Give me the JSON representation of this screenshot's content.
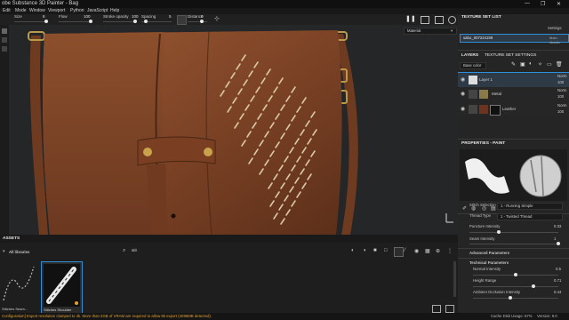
{
  "window": {
    "title": "obe Substance 3D Painter - Bag",
    "controls": [
      "—",
      "❐",
      "✕"
    ]
  },
  "menu": [
    "Edit",
    "Mode",
    "Window",
    "Viewport",
    "Python",
    "JavaScript",
    "Help"
  ],
  "toolbar": {
    "size_label": "Size",
    "size_value": "8",
    "flow_label": "Flow",
    "flow_value": "100",
    "stroke_opacity_label": "Stroke opacity",
    "stroke_opacity_value": "100",
    "spacing_label": "Spacing",
    "spacing_value": "5",
    "distance_label": "Distance",
    "distance_value": "0"
  },
  "viewport": {
    "material_mode": "Material"
  },
  "texture_set_list": {
    "title": "TEXTURE SET LIST",
    "settings_label": "Settings",
    "item_name": "sabo_007224198",
    "shader": "Main shader"
  },
  "layers_panel": {
    "tab_layers": "LAYERS",
    "tab_texture_set_settings": "TEXTURE SET SETTINGS",
    "channel": "Base color",
    "layers": [
      {
        "name": "Layer 1",
        "blend": "Norm",
        "opacity": "100"
      },
      {
        "name": "Metal",
        "blend": "Norm",
        "opacity": "100"
      },
      {
        "name": "Leather",
        "blend": "Norm",
        "opacity": "100"
      }
    ]
  },
  "properties": {
    "title": "PROPERTIES - PAINT",
    "stitch_selection_label": "Stitch Selection",
    "stitch_selection_value": "1 - Running Simple",
    "thread_type_label": "Thread Type",
    "thread_type_value": "1 - Twisted Thread",
    "puncture_intensity_label": "Puncture Intensity",
    "puncture_intensity_value": "0.33",
    "puncture_intensity_level": 0.33,
    "seam_intensity_label": "Seam Intensity",
    "seam_intensity_value": "1",
    "seam_intensity_level": 1.0,
    "advanced_params": "Advanced Parameters",
    "technical_params": "Technical Parameters",
    "normal_intensity_label": "Normal Intensity",
    "normal_intensity_value": "0.5",
    "normal_intensity_level": 0.5,
    "height_range_label": "Height Range",
    "height_range_value": "0.71",
    "height_range_level": 0.71,
    "ao_intensity_label": "Ambient Occlusion Intensity",
    "ao_intensity_value": "0.44",
    "ao_intensity_level": 0.44
  },
  "assets": {
    "title": "ASSETS",
    "library": "All libraries",
    "search_value": "stit",
    "thumb1_label": "Stitches Seam...",
    "thumb2_label": "Stitches Shoulder"
  },
  "status": {
    "message": "Configuration] Export resolution clamped to 4k. More than 2GB of VRAM are required to allow 8k export (4096MB detected).",
    "cache": "Cache Disk Usage:",
    "cache_value": "67%",
    "version": "Version: 9.0"
  },
  "colors": {
    "accent": "#2f8fd8",
    "leather": "#8a4a2a",
    "panel": "#252525"
  }
}
